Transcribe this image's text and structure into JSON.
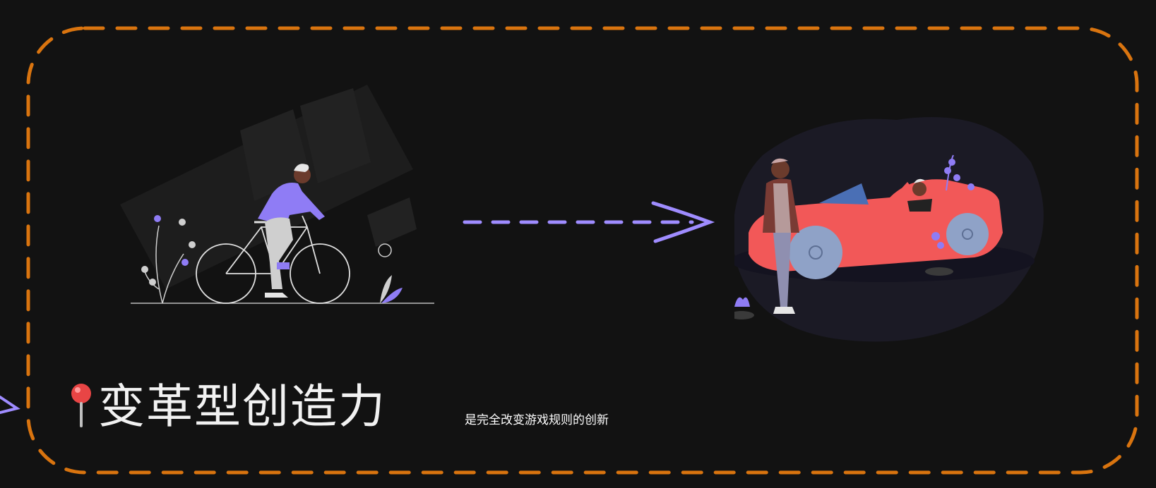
{
  "title": "变革型创造力",
  "subtitle": "是完全改变游戏规则的创新",
  "colors": {
    "background": "#121212",
    "frame_dash": "#d9740f",
    "accent_purple": "#9f8cff",
    "car_red": "#f25858",
    "text_white": "#f2f2f2"
  },
  "icons": {
    "pin": "map-pin-icon",
    "bicycle_illustration": "person-on-bicycle-illustration",
    "car_illustration": "people-with-red-convertible-illustration",
    "arrow": "dashed-right-arrow-icon"
  }
}
